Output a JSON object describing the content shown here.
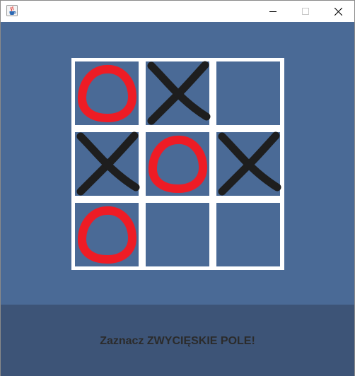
{
  "window": {
    "icon": "java-coffee-cup-icon",
    "controls": [
      "minimize-icon",
      "maximize-icon",
      "close-icon"
    ]
  },
  "board": {
    "cells": [
      [
        "O",
        "X",
        ""
      ],
      [
        "X",
        "O",
        "X"
      ],
      [
        "O",
        "",
        ""
      ]
    ],
    "colors": {
      "background": "#4a6a96",
      "grid": "#ffffff",
      "o_mark": "#ee1c25",
      "x_mark": "#1e1e1e"
    }
  },
  "status": {
    "message": "Zaznacz ZWYCIĘSKIE POLE!"
  },
  "colors": {
    "footer": "#3d5477",
    "status_text": "#2b2b2b"
  }
}
